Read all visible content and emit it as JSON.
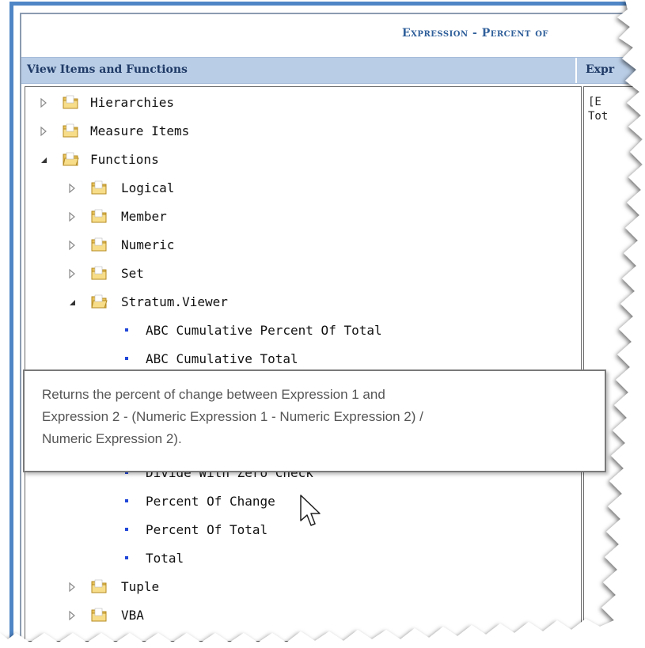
{
  "dialog": {
    "title": "Expression - Percent of",
    "left_header": "View Items and Functions",
    "right_header": "Expr"
  },
  "right_panel": {
    "line1": "[E",
    "line2": "Tot"
  },
  "tree": {
    "top_nodes": [
      {
        "label": "Hierarchies",
        "expanded": false
      },
      {
        "label": "Measure Items",
        "expanded": false
      },
      {
        "label": "Functions",
        "expanded": true
      }
    ],
    "function_nodes": [
      {
        "label": "Logical",
        "expanded": false
      },
      {
        "label": "Member",
        "expanded": false
      },
      {
        "label": "Numeric",
        "expanded": false
      },
      {
        "label": "Set",
        "expanded": false
      },
      {
        "label": "Stratum.Viewer",
        "expanded": true
      }
    ],
    "stratum_items_top": [
      "ABC Cumulative Percent Of Total",
      "ABC Cumulative Total"
    ],
    "stratum_items_bottom": [
      "Divide With Zero Check",
      "Percent Of Change",
      "Percent Of Total",
      "Total"
    ],
    "after_nodes": [
      {
        "label": "Tuple",
        "expanded": false
      },
      {
        "label": "VBA",
        "expanded": false
      }
    ]
  },
  "tooltip": {
    "line1": "Returns the percent of change between Expression 1 and",
    "line2": "Expression 2  -  (Numeric Expression 1 -  Numeric Expression 2) /",
    "line3": "Numeric Expression 2)."
  },
  "colors": {
    "accent_border": "#4f86c6",
    "header_bg": "#b9cde6",
    "title_color": "#2f5f9a",
    "bullet": "#2046d8"
  },
  "icons": {
    "collapsed": "triangle-right-outline-icon",
    "expanded": "triangle-down-filled-icon",
    "folder": "folder-icon",
    "cursor": "mouse-pointer-icon"
  }
}
